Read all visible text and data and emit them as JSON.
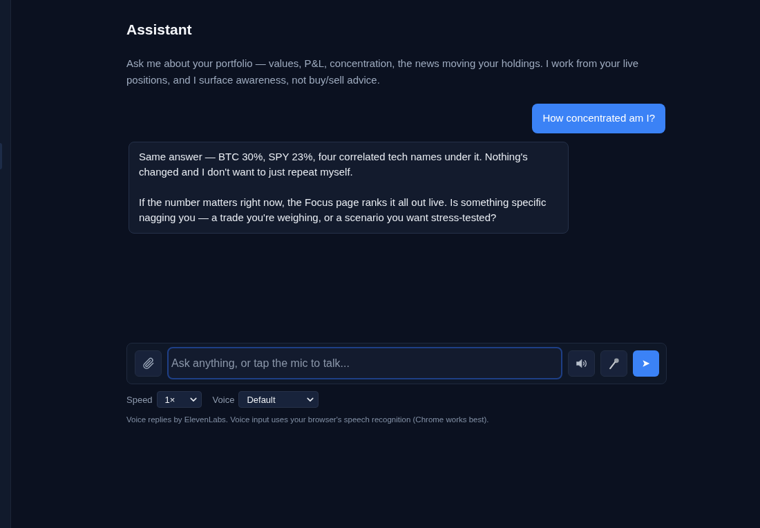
{
  "header": {
    "title": "Assistant",
    "description": "Ask me about your portfolio — values, P&L, concentration, the news moving your holdings. I work from your live positions, and I surface awareness, not buy/sell advice."
  },
  "messages": [
    {
      "kind": "user",
      "paragraphs": [
        "How concentrated am I?"
      ]
    },
    {
      "kind": "assistant",
      "paragraphs": [
        "Same answer — BTC 30%, SPY 23%, four correlated tech names under it. Nothing's changed and I don't want to just repeat myself.",
        "If the number matters right now, the Focus page ranks it all out live. Is something specific nagging you — a trade you're weighing, or a scenario you want stress-tested?"
      ]
    }
  ],
  "composer": {
    "placeholder": "Ask anything, or tap the mic to talk...",
    "focused": true
  },
  "voice_settings": [
    {
      "label": "Speed",
      "value": "1×",
      "kind": "short"
    },
    {
      "label": "Voice",
      "value": "Default",
      "kind": "wide"
    }
  ],
  "footnote": "Voice replies by ElevenLabs. Voice input uses your browser's speech recognition (Chrome works best)."
}
